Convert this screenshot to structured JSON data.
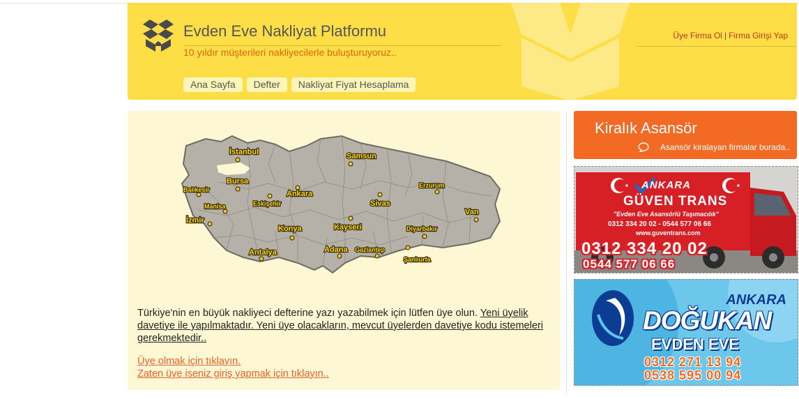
{
  "header": {
    "title": "Evden Eve Nakliyat Platformu",
    "subtitle": "10 yıldır müşterileri nakliyecilerle buluşturuyoruz..",
    "links": {
      "register": "Üye Firma Ol",
      "separator": "|",
      "login": "Firma Girişi Yap"
    },
    "nav": [
      "Ana Sayfa",
      "Defter",
      "Nakliyat Fiyat Hesaplama"
    ]
  },
  "map": {
    "cities": [
      "İstanbul",
      "Samsun",
      "Balıkesir",
      "Bursa",
      "Eskişehir",
      "Ankara",
      "Sivas",
      "Erzurum",
      "Manisa",
      "İzmir",
      "Konya",
      "Kayseri",
      "Diyarbakır",
      "Van",
      "Antalya",
      "Adana",
      "Gaziantep",
      "Şanlıurfa"
    ]
  },
  "main": {
    "intro_plain": "Türkiye'nin en büyük nakliyeci defterine yazı yazabilmek için lütfen üye olun. ",
    "intro_underlined": "Yeni üyelik davetiye ile yapılmaktadır. Yeni üye olacakların, mevcut üyelerden davetiye kodu istemeleri gerekmektedir..",
    "register_link": "Üye olmak için tıklayın.",
    "login_link": "Zaten üye iseniz giriş yapmak için tıklayın.."
  },
  "sidebar": {
    "promo_title": "Kiralık Asansör",
    "promo_sub": "Asansör kiralayan firmalar burada..",
    "ad1": {
      "title": "ANKARA",
      "company": "GÜVEN TRANS",
      "slogan": "\"Evden Eve Asansörlü Taşımacılık\"",
      "phones": "0312 334 20 02 - 0544 577 06 66",
      "website": "www.guventrans.com",
      "phone1": "0312 334 20 02",
      "phone2": "0544 577 06 66"
    },
    "ad2": {
      "city": "ANKARA",
      "company": "DOĞUKAN",
      "sub": "EVDEN EVE",
      "phone1": "0312 271 13 94",
      "phone2": "0538 595 00 94"
    }
  },
  "colors": {
    "header_bg": "#fede47",
    "main_bg": "#fef7d3",
    "orange": "#f26a24",
    "link": "#e8622a"
  }
}
